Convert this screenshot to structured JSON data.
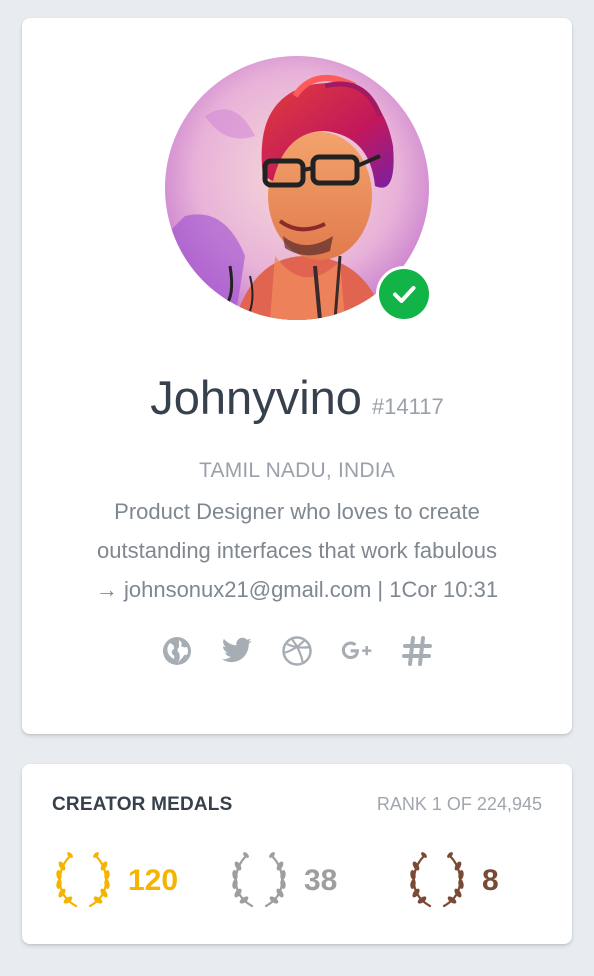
{
  "profile": {
    "name": "Johnyvino",
    "user_id": "#14117",
    "location": "TAMIL NADU, INDIA",
    "bio_line1": "Product Designer who loves to create",
    "bio_line2": "outstanding interfaces that work fabulous",
    "bio_line3": "→ johnsonux21@gmail.com | 1Cor 10:31",
    "verified": true
  },
  "socials": [
    {
      "icon": "globe-icon"
    },
    {
      "icon": "twitter-icon"
    },
    {
      "icon": "dribbble-icon"
    },
    {
      "icon": "google-plus-icon"
    },
    {
      "icon": "hashtag-icon"
    }
  ],
  "medals": {
    "title": "CREATOR MEDALS",
    "rank": "RANK 1 OF 224,945",
    "items": [
      {
        "type": "gold",
        "count": "120",
        "color": "#f5b400"
      },
      {
        "type": "silver",
        "count": "38",
        "color": "#9e9e9e"
      },
      {
        "type": "bronze",
        "count": "8",
        "color": "#7a4a35"
      }
    ]
  },
  "colors": {
    "verified": "#12b347",
    "icon_gray": "#a7adb5",
    "text_dark": "#37404d"
  }
}
